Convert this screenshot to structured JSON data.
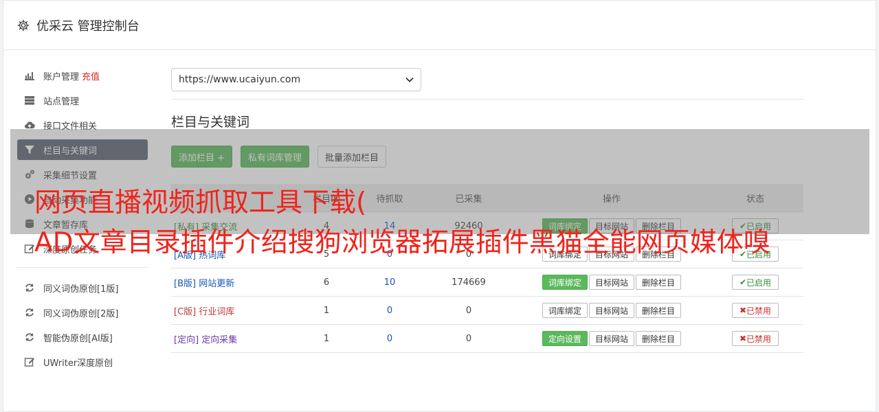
{
  "header": {
    "title": "优采云 管理控制台"
  },
  "sidebar": {
    "items": [
      {
        "label": "账户管理",
        "badge": "充值",
        "icon": "bar-chart-icon"
      },
      {
        "label": "站点管理",
        "icon": "server-icon"
      },
      {
        "label": "接口文件相关",
        "icon": "cloud-upload-icon"
      },
      {
        "label": "栏目与关键词",
        "icon": "filter-icon",
        "active": true
      },
      {
        "label": "采集细节设置",
        "icon": "gears-icon"
      },
      {
        "label": "自动采集功能",
        "icon": "play-circle-icon"
      },
      {
        "label": "文章暂存库",
        "icon": "database-icon"
      },
      {
        "label": "深度原创任务",
        "icon": "edit-icon"
      }
    ],
    "items2": [
      {
        "label": "同义词伪原创[1版]",
        "icon": "refresh-icon"
      },
      {
        "label": "同义词伪原创[2版]",
        "icon": "refresh-icon"
      },
      {
        "label": "智能伪原创[AI版]",
        "icon": "refresh-icon"
      },
      {
        "label": "UWriter深度原创",
        "icon": "edit-icon"
      }
    ]
  },
  "main": {
    "site_select": {
      "value": "https://www.ucaiyun.com"
    },
    "section_title": "栏目与关键词",
    "buttons": {
      "add_column": "添加栏目 +",
      "private_lexicon": "私有词库管理",
      "batch_add": "批量添加栏目"
    },
    "table": {
      "headers": [
        "栏目ID",
        "待抓取",
        "已采集",
        "操作",
        "状态"
      ],
      "rows": [
        {
          "tag": "[私有]",
          "name": "采集交流",
          "id": "4",
          "pending": "14",
          "collected": "92460",
          "op1": "词库绑定",
          "op1_primary": true,
          "op2": "目标网站",
          "op3": "删除栏目",
          "status": "已启用",
          "enabled": true,
          "color": "green"
        },
        {
          "tag": "[A版]",
          "name": "热词库",
          "id": "5",
          "pending": "0",
          "collected": "0",
          "op1": "词库绑定",
          "op1_primary": false,
          "op2": "目标网站",
          "op3": "删除栏目",
          "status": "已启用",
          "enabled": true,
          "color": "blue"
        },
        {
          "tag": "[B版]",
          "name": "网站更新",
          "id": "6",
          "pending": "10",
          "collected": "174669",
          "op1": "词库绑定",
          "op1_primary": true,
          "op2": "目标网站",
          "op3": "删除栏目",
          "status": "已启用",
          "enabled": true,
          "color": "blue"
        },
        {
          "tag": "[C版]",
          "name": "行业词库",
          "id": "1",
          "pending": "0",
          "collected": "0",
          "op1": "词库绑定",
          "op1_primary": false,
          "op2": "目标网站",
          "op3": "删除栏目",
          "status": "已禁用",
          "enabled": false,
          "color": "red"
        },
        {
          "tag": "[定向]",
          "name": "定向采集",
          "id": "1",
          "pending": "0",
          "collected": "0",
          "op1": "定向设置",
          "op1_primary": true,
          "op2": "目标网站",
          "op3": "删除栏目",
          "status": "已禁用",
          "enabled": false,
          "color": "purple"
        }
      ]
    }
  },
  "overlay": {
    "line1": "网页直播视频抓取工具下载(",
    "line2": "AD文章目录插件介绍搜狗浏览器拓展插件黑猫全能网页媒体嗅"
  },
  "colors": {
    "accent_green": "#5cb85c",
    "active_sidebar": "#5a6170",
    "overlay_text": "#f0231b"
  }
}
